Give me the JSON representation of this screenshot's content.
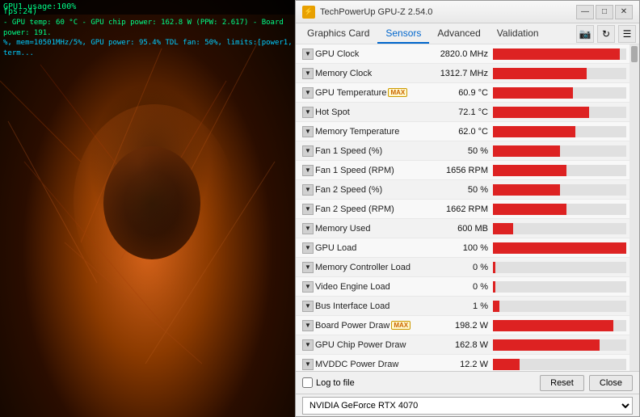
{
  "window": {
    "title": "TechPowerUp GPU-Z 2.54.0",
    "icon": "⚡"
  },
  "title_controls": {
    "minimize": "—",
    "maximize": "□",
    "close": "✕"
  },
  "tabs": {
    "graphics_card": "Graphics Card",
    "sensors": "Sensors",
    "advanced": "Advanced",
    "validation": "Validation",
    "active": "Sensors"
  },
  "left_panel": {
    "usage_label": "GPU1 usage:100%",
    "overlay_lines": [
      "fps:24)",
      "- GPU temp: 60 °C - GPU chip power: 162.8 W (PPW: 2.617) - Board power: 191.",
      "%, mem=10501MHz/5%, GPU power: 95.4% TDL fan: 50%, limits:[power1, term..."
    ]
  },
  "sensors": [
    {
      "name": "GPU Clock",
      "badge": "",
      "value": "2820.0 MHz",
      "bar_pct": 95
    },
    {
      "name": "Memory Clock",
      "badge": "",
      "value": "1312.7 MHz",
      "bar_pct": 70
    },
    {
      "name": "GPU Temperature",
      "badge": "MAX",
      "value": "60.9 °C",
      "bar_pct": 60
    },
    {
      "name": "Hot Spot",
      "badge": "",
      "value": "72.1 °C",
      "bar_pct": 72
    },
    {
      "name": "Memory Temperature",
      "badge": "",
      "value": "62.0 °C",
      "bar_pct": 62
    },
    {
      "name": "Fan 1 Speed (%)",
      "badge": "",
      "value": "50 %",
      "bar_pct": 50
    },
    {
      "name": "Fan 1 Speed (RPM)",
      "badge": "",
      "value": "1656 RPM",
      "bar_pct": 55
    },
    {
      "name": "Fan 2 Speed (%)",
      "badge": "",
      "value": "50 %",
      "bar_pct": 50
    },
    {
      "name": "Fan 2 Speed (RPM)",
      "badge": "",
      "value": "1662 RPM",
      "bar_pct": 55
    },
    {
      "name": "Memory Used",
      "badge": "",
      "value": "600 MB",
      "bar_pct": 15
    },
    {
      "name": "GPU Load",
      "badge": "",
      "value": "100 %",
      "bar_pct": 100
    },
    {
      "name": "Memory Controller Load",
      "badge": "",
      "value": "0 %",
      "bar_pct": 2
    },
    {
      "name": "Video Engine Load",
      "badge": "",
      "value": "0 %",
      "bar_pct": 2
    },
    {
      "name": "Bus Interface Load",
      "badge": "",
      "value": "1 %",
      "bar_pct": 5
    },
    {
      "name": "Board Power Draw",
      "badge": "MAX",
      "value": "198.2 W",
      "bar_pct": 90
    },
    {
      "name": "GPU Chip Power Draw",
      "badge": "",
      "value": "162.8 W",
      "bar_pct": 80
    },
    {
      "name": "MVDDC Power Draw",
      "badge": "",
      "value": "12.2 W",
      "bar_pct": 20
    }
  ],
  "bottom": {
    "log_label": "Log to file",
    "reset_btn": "Reset",
    "close_btn": "Close"
  },
  "footer": {
    "gpu_name": "NVIDIA GeForce RTX 4070",
    "gpu_options": [
      "NVIDIA GeForce RTX 4070"
    ]
  }
}
